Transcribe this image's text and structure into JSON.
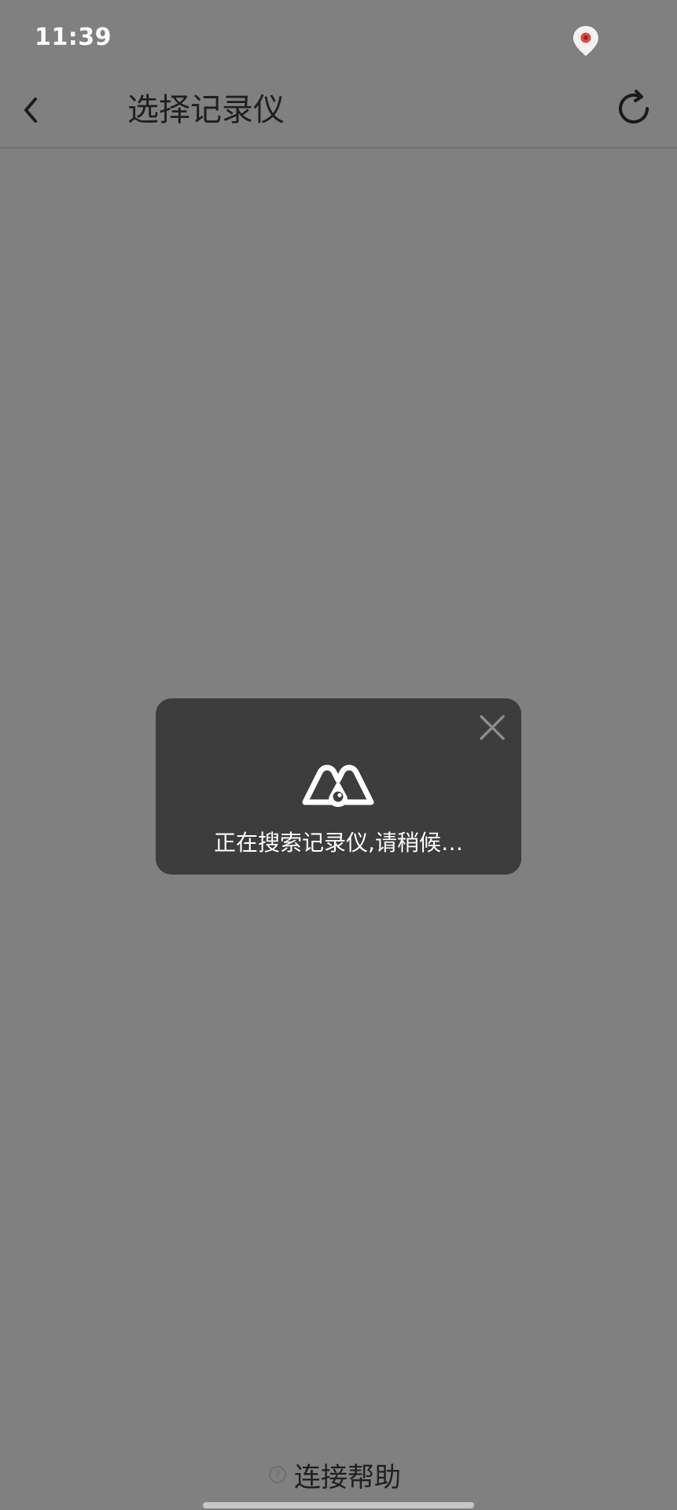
{
  "status_bar": {
    "time": "11:39",
    "icon": "location-pin-icon"
  },
  "app_bar": {
    "back_icon": "chevron-left-icon",
    "title": "选择记录仪",
    "refresh_icon": "refresh-icon"
  },
  "loading_dialog": {
    "logo_icon": "brand-logo-icon",
    "message": "正在搜索记录仪,请稍候…",
    "close_icon": "close-icon"
  },
  "footer": {
    "help_icon_glyph": "?",
    "help_label": "连接帮助"
  },
  "colors": {
    "overlay": "#808080",
    "dialog": "#3d3d3d",
    "text_dark": "#1f1f1f",
    "text_light": "#ffffff",
    "accent_red": "#e2463d"
  }
}
